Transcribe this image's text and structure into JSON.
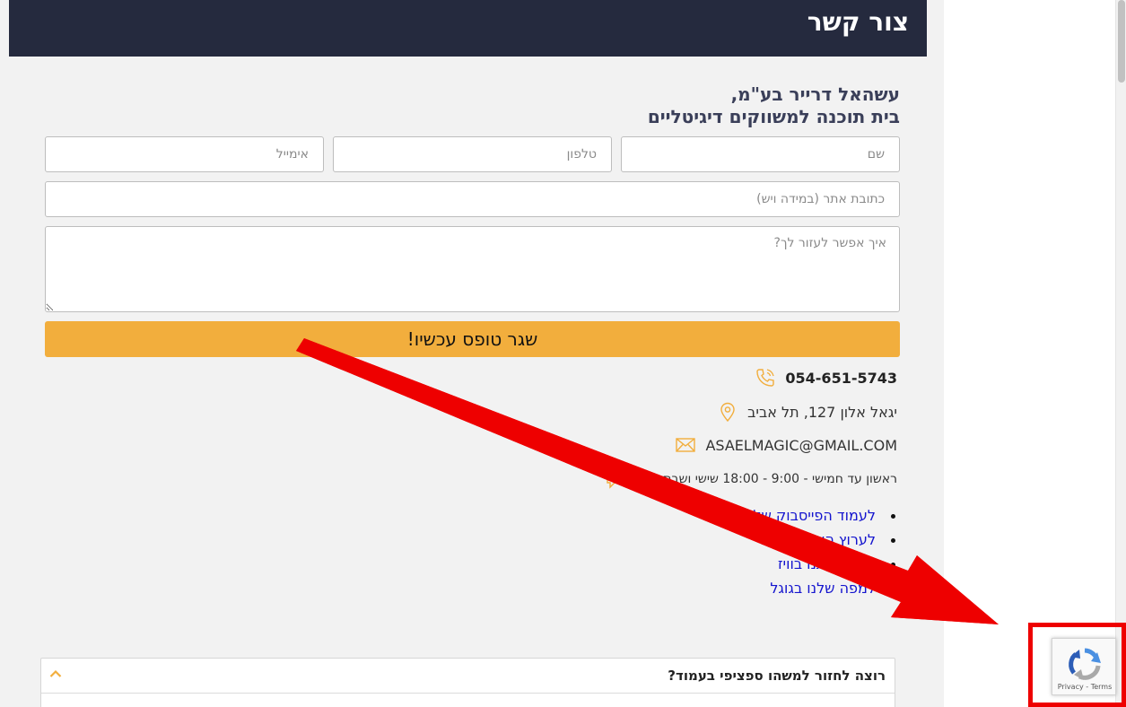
{
  "header": {
    "title": "צור קשר"
  },
  "company": {
    "line1": "עשהאל דרייר בע\"מ,",
    "line2": "בית תוכנה למשווקים דיגיטליים"
  },
  "form": {
    "name_placeholder": "שם",
    "phone_placeholder": "טלפון",
    "email_placeholder": "אימייל",
    "website_placeholder": "כתובת אתר (במידה ויש)",
    "message_placeholder": "איך אפשר לעזור לך?",
    "submit_label": "שגר טופס עכשיו!"
  },
  "contact": {
    "phone": "054-651-5743",
    "address": "יגאל אלון 127, תל אביב",
    "email": "ASAELMAGIC@GMAIL.COM",
    "hours": "ראשון עד חמישי - 9:00 - 18:00 שישי ושבת סגור"
  },
  "links": [
    {
      "label": "לעמוד הפייסבוק שלנו"
    },
    {
      "label": "לערוץ היוטיוב שלנו"
    },
    {
      "label": "מצאו אותנו בוויז"
    },
    {
      "label": "למפה שלנו בגוגל"
    }
  ],
  "accordion": {
    "title": "רוצה לחזור למשהו ספציפי בעמוד?"
  },
  "recaptcha": {
    "privacy": "Privacy",
    "separator": " - ",
    "terms": "Terms"
  },
  "colors": {
    "header_bg": "#252a3e",
    "accent": "#f2ae3d",
    "link": "#1414ce",
    "annotation_red": "#ee0000"
  }
}
